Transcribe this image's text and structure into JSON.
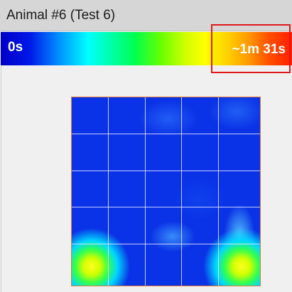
{
  "window": {
    "title": "Animal #6 (Test 6)"
  },
  "legend": {
    "min_label": "0s",
    "max_label": "~1m 31s",
    "colors": {
      "low": "#0000c8",
      "mid": "#00ff50",
      "high": "#ff1e00"
    }
  },
  "heatmap": {
    "grid_cells": 5,
    "border_color": "#e87830",
    "highlight_color": "#e0181c"
  }
}
